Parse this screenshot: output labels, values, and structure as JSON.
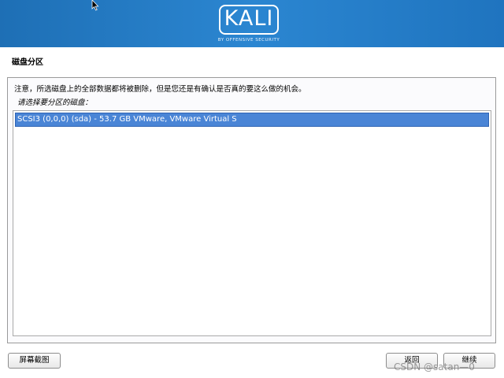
{
  "header": {
    "logo_text": "KALI",
    "logo_tagline": "BY OFFENSIVE SECURITY"
  },
  "page": {
    "title": "磁盘分区",
    "notice": "注意，所选磁盘上的全部数据都将被删除，但是您还是有确认是否真的要这么做的机会。",
    "prompt": "请选择要分区的磁盘："
  },
  "disks": [
    {
      "label": "SCSI3 (0,0,0) (sda) - 53.7 GB VMware, VMware Virtual S",
      "selected": true
    }
  ],
  "buttons": {
    "screenshot": "屏幕截图",
    "back": "返回",
    "continue": "继续"
  },
  "watermark": "CSDN @satan—0",
  "colors": {
    "banner": "#2b86d1",
    "selection": "#4a85d6"
  }
}
